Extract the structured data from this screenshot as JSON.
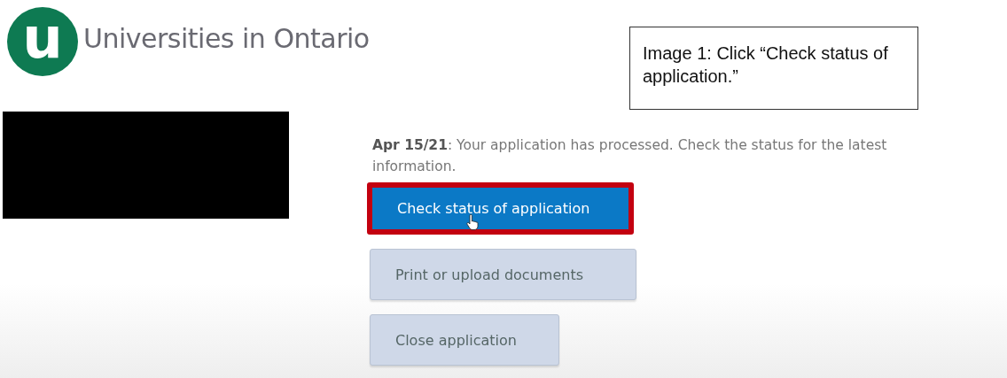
{
  "header": {
    "logo_letter": "u",
    "site_name": "Universities in Ontario"
  },
  "annotation": {
    "text": "Image 1: Click “Check status of application.”"
  },
  "message": "**Apr 15/21**: Your application has processed. Check the status for the latest information.",
  "buttons": [
    {
      "label": "Check status of application",
      "kind": "primary",
      "highlighted": true,
      "hovered": true
    },
    {
      "label": "Print or upload documents",
      "kind": "secondary",
      "highlighted": false,
      "hovered": false
    },
    {
      "label": "Close application",
      "kind": "secondary",
      "highlighted": false,
      "hovered": false
    }
  ]
}
